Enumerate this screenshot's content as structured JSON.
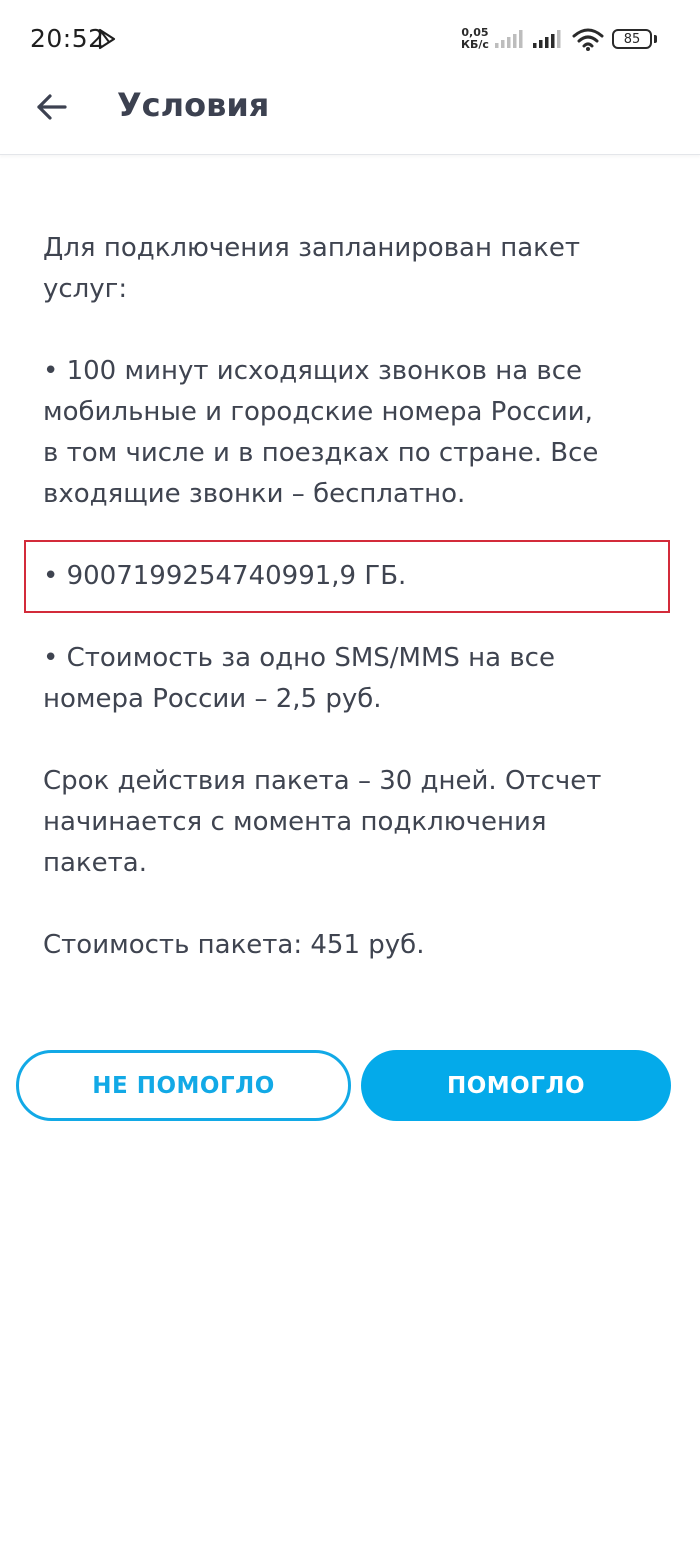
{
  "status_bar": {
    "time": "20:52",
    "net_speed_value": "0,05",
    "net_speed_unit": "КБ/с",
    "battery": "85"
  },
  "header": {
    "title": "Условия"
  },
  "content": {
    "intro_line1": "Для подключения запланирован пакет",
    "intro_line2": "услуг:",
    "calls_line1": "• 100 минут исходящих звонков на все",
    "calls_line2": "мобильные и городские номера России,",
    "calls_line3": "в том числе и в поездках по стране. Все",
    "calls_line4": "входящие звонки – бесплатно.",
    "internet": "• 9007199254740991,9 ГБ.",
    "sms_line1": "• Стоимость за одно SMS/MMS на все",
    "sms_line2": "номера России – 2,5 руб.",
    "validity_line1": "Срок действия пакета – 30 дней. Отсчет",
    "validity_line2": "начинается с момента подключения",
    "validity_line3": "пакета.",
    "price": "Стоимость пакета: 451 руб."
  },
  "actions": {
    "not_helped": "НЕ ПОМОГЛО",
    "helped": "ПОМОГЛО"
  },
  "colors": {
    "accent": "#04aaea",
    "highlight_border": "#d32b3a",
    "text": "#3f4450"
  }
}
